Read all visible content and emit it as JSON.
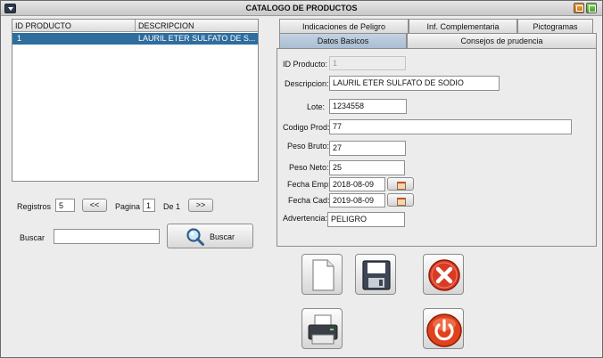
{
  "window": {
    "title": "CATALOGO DE PRODUCTOS"
  },
  "table": {
    "columns": [
      "ID PRODUCTO",
      "DESCRIPCION"
    ],
    "rows": [
      {
        "id": "1",
        "descripcion": "LAURIL ETER SULFATO DE S..."
      }
    ]
  },
  "pagination": {
    "registros_label": "Registros",
    "registros_value": "5",
    "prev_label": "<<",
    "pagina_label": "Pagina",
    "pagina_value": "1",
    "de_label": "De 1",
    "next_label": ">>"
  },
  "search": {
    "label": "Buscar",
    "value": "",
    "button_label": "Buscar"
  },
  "tabs": {
    "row_top": [
      "Indicaciones de Peligro",
      "Inf. Complementaria",
      "Pictogramas"
    ],
    "row_bottom": [
      "Datos Basicos",
      "Consejos de prudencia"
    ],
    "active": "Datos Basicos"
  },
  "form": {
    "id_producto": {
      "label": "ID Producto:",
      "value": "1"
    },
    "descripcion": {
      "label": "Descripcion:",
      "value": "LAURIL ETER SULFATO DE SODIO"
    },
    "lote": {
      "label": "Lote:",
      "value": "1234558"
    },
    "codigo_prod": {
      "label": "Codigo Prod:",
      "value": "77"
    },
    "peso_bruto": {
      "label": "Peso Bruto:",
      "value": "27"
    },
    "peso_neto": {
      "label": "Peso Neto:",
      "value": "25"
    },
    "fecha_emp": {
      "label": "Fecha Emp:",
      "value": "2018-08-09"
    },
    "fecha_cad": {
      "label": "Fecha Cad:",
      "value": "2019-08-09"
    },
    "advertencia": {
      "label": "Advertencia:",
      "value": "PELIGRO"
    }
  },
  "icons": {
    "new": "new-document-icon",
    "save": "save-icon",
    "delete": "delete-icon",
    "print": "printer-icon",
    "exit": "power-icon",
    "search": "magnifier-icon"
  },
  "colors": {
    "selection": "#2e6d9e",
    "active_tab": "#b4c6da",
    "delete_red": "#d93a23",
    "exit_red": "#e0421c"
  }
}
